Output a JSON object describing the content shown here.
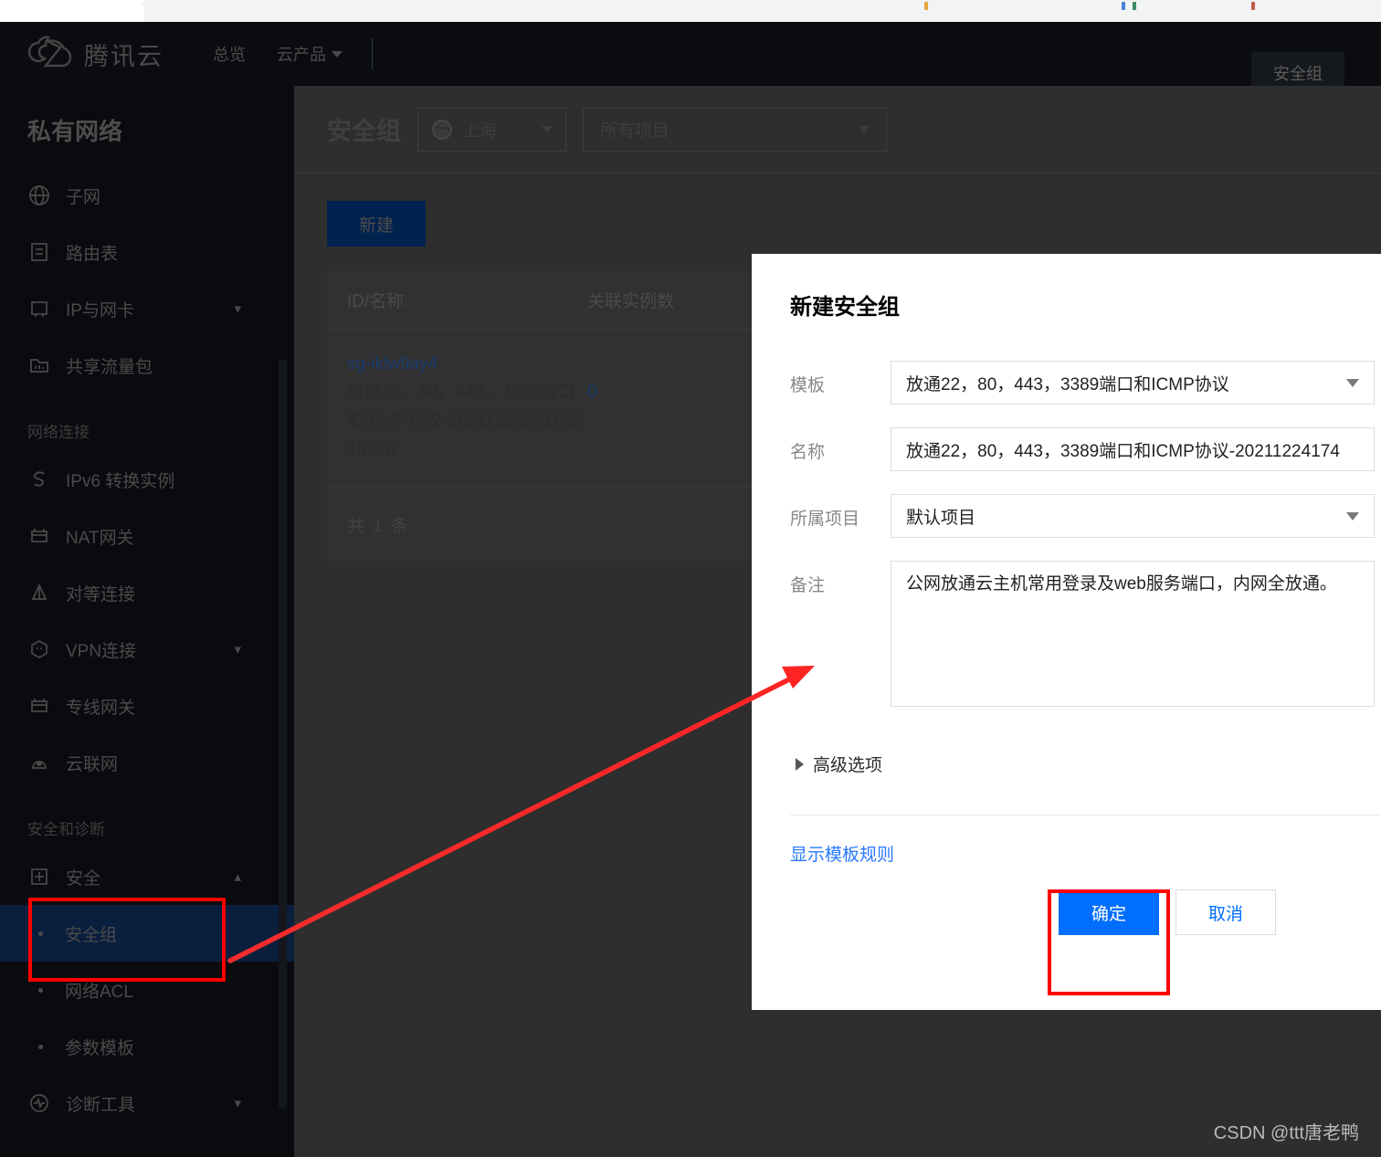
{
  "browser": {
    "tab_dot_colors": [
      "#e8a33d",
      "#4a7fd4",
      "#3d8b5f",
      "#c25a4a"
    ]
  },
  "topnav": {
    "brand": "腾讯云",
    "links": [
      {
        "label": "总览",
        "has_caret": false
      },
      {
        "label": "云产品",
        "has_caret": true
      }
    ],
    "tab_label": "安全组"
  },
  "sidebar": {
    "title": "私有网络",
    "items": [
      {
        "label": "子网",
        "icon": "globe-icon",
        "chevron": ""
      },
      {
        "label": "路由表",
        "icon": "document-icon",
        "chevron": ""
      },
      {
        "label": "IP与网卡",
        "icon": "chip-icon",
        "chevron": "down"
      },
      {
        "label": "共享流量包",
        "icon": "chart-folder-icon",
        "chevron": ""
      }
    ],
    "group_network": "网络连接",
    "network_items": [
      {
        "label": "IPv6 转换实例",
        "icon": "s-hex-icon",
        "chevron": ""
      },
      {
        "label": "NAT网关",
        "icon": "gateway-icon",
        "chevron": ""
      },
      {
        "label": "对等连接",
        "icon": "peering-icon",
        "chevron": ""
      },
      {
        "label": "VPN连接",
        "icon": "vpn-icon",
        "chevron": "down"
      },
      {
        "label": "专线网关",
        "icon": "gateway-icon",
        "chevron": ""
      },
      {
        "label": "云联网",
        "icon": "cloud-connect-icon",
        "chevron": ""
      }
    ],
    "group_security": "安全和诊断",
    "security_parent": {
      "label": "安全",
      "icon": "shield-plus-icon",
      "chevron": "up"
    },
    "security_children": [
      {
        "label": "安全组",
        "selected": true
      },
      {
        "label": "网络ACL",
        "selected": false
      },
      {
        "label": "参数模板",
        "selected": false
      }
    ],
    "diagnostics": {
      "label": "诊断工具",
      "icon": "pulse-icon",
      "chevron": "down"
    }
  },
  "page": {
    "title": "安全组",
    "region": "上海",
    "project_filter": "所有项目",
    "new_button": "新建"
  },
  "table": {
    "columns": [
      "ID/名称",
      "关联实例数"
    ],
    "rows": [
      {
        "id": "sg-iklw9ay4",
        "name": "放通22，80，443，3389端口和ICMP协议-20211223221852 18726",
        "instances": "0"
      }
    ],
    "footer": "共 1 条"
  },
  "modal": {
    "title": "新建安全组",
    "fields": [
      {
        "label": "模板",
        "value": "放通22，80，443，3389端口和ICMP协议",
        "type": "select"
      },
      {
        "label": "名称",
        "value": "放通22，80，443，3389端口和ICMP协议-20211224174",
        "type": "input"
      },
      {
        "label": "所属项目",
        "value": "默认项目",
        "type": "select"
      },
      {
        "label": "备注",
        "value": "公网放通云主机常用登录及web服务端口，内网全放通。",
        "type": "textarea"
      }
    ],
    "advanced_label": "高级选项",
    "template_rules_link": "显示模板规则",
    "confirm_label": "确定",
    "cancel_label": "取消"
  },
  "annotations": {
    "highlight_color": "#ff0000",
    "arrow_from": "安全组",
    "arrow_to": "备注"
  },
  "watermark": "CSDN @ttt唐老鸭"
}
